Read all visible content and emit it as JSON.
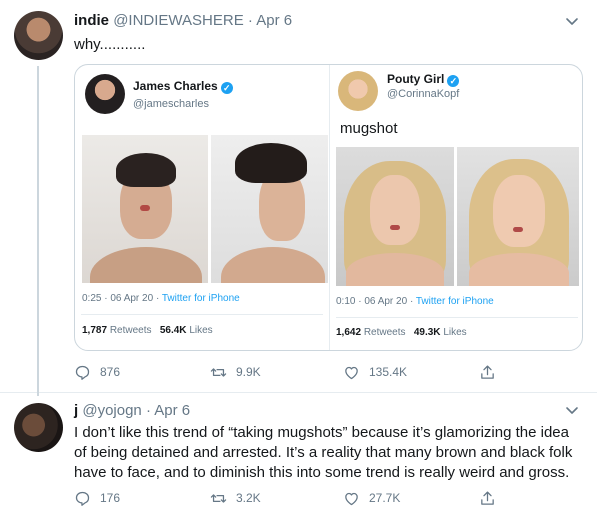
{
  "tweets": [
    {
      "name": "indie",
      "handle": "@INDIEWASHERE",
      "dot": "·",
      "date": "Apr 6",
      "text": "why...........",
      "quote": {
        "left": {
          "name": "James Charles",
          "handle": "@jamescharles",
          "time": "0:25 · 06 Apr 20 · ",
          "source": "Twitter for iPhone",
          "retweets_count": "1,787",
          "retweets_label": "Retweets",
          "likes_count": "56.4K",
          "likes_label": "Likes"
        },
        "right": {
          "name": "Pouty Girl",
          "handle": "@CorinnaKopf",
          "text": "mugshot",
          "time": "0:10 · 06 Apr 20 · ",
          "source": "Twitter for iPhone",
          "retweets_count": "1,642",
          "retweets_label": "Retweets",
          "likes_count": "49.3K",
          "likes_label": "Likes"
        }
      },
      "replies": "876",
      "retweets": "9.9K",
      "likes": "135.4K"
    },
    {
      "name": "j",
      "handle": "@yojogn",
      "dot": "·",
      "date": "Apr 6",
      "text": "I don’t like this trend of “taking mugshots” because it’s glamorizing the idea of being detained and arrested. It’s a reality that many brown and black folk have to face, and to diminish this into some trend is really weird and gross.",
      "replies": "176",
      "retweets": "3.2K",
      "likes": "27.7K"
    }
  ],
  "icons": {
    "reply": "reply-icon",
    "retweet": "retweet-icon",
    "like": "heart-icon",
    "share": "share-icon",
    "more": "chevron-down-icon",
    "verified": "verified-badge-icon"
  },
  "colors": {
    "link": "#1da1f2",
    "muted": "#657786",
    "text": "#14171a",
    "border": "#e6ecf0"
  }
}
